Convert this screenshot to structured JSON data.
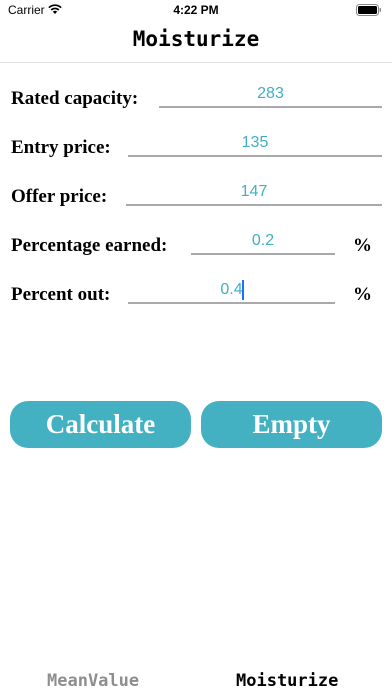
{
  "status_bar": {
    "carrier": "Carrier",
    "time": "4:22 PM"
  },
  "nav": {
    "title": "Moisturize"
  },
  "form": {
    "rated_capacity": {
      "label": "Rated capacity:",
      "value": "283"
    },
    "entry_price": {
      "label": "Entry price:",
      "value": "135"
    },
    "offer_price": {
      "label": "Offer price:",
      "value": "147"
    },
    "percentage_earned": {
      "label": "Percentage earned:",
      "value": "0.2",
      "unit": "%"
    },
    "percent_out": {
      "label": "Percent out:",
      "value": "0.4",
      "unit": "%"
    }
  },
  "buttons": {
    "calculate": "Calculate",
    "empty": "Empty"
  },
  "tabs": [
    {
      "label": "MeanValue",
      "color": "#8e8e8e"
    },
    {
      "label": "Moisturize",
      "color": "#000000"
    }
  ],
  "colors": {
    "accent": "#44b1c2",
    "input_text": "#3fb0c4"
  }
}
